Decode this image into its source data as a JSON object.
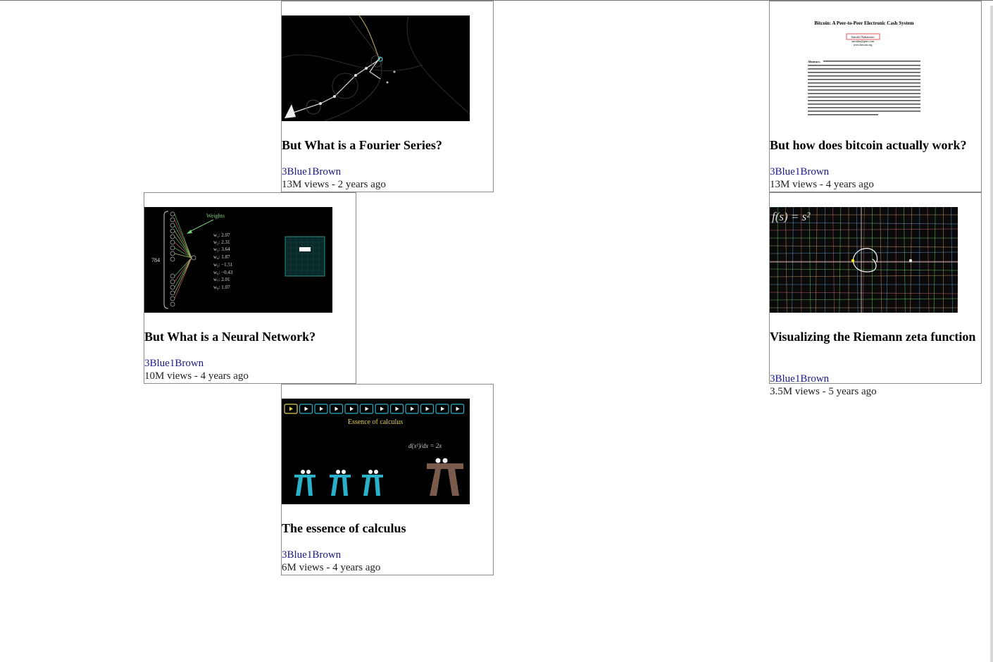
{
  "videos": [
    {
      "title": "But What is a Fourier Series?",
      "channel": "3Blue1Brown",
      "views": "13M views",
      "age": "2 years ago",
      "meta": "13M views - 2 years ago",
      "thumbnail": "fourier"
    },
    {
      "title": "But how does bitcoin actually work?",
      "channel": "3Blue1Brown",
      "views": "13M views",
      "age": "4 years ago",
      "meta": "13M views - 4 years ago",
      "thumbnail": "bitcoin-paper"
    },
    {
      "title": "But What is a Neural Network?",
      "channel": "3Blue1Brown",
      "views": "10M views",
      "age": "4 years ago",
      "meta": "10M views - 4 years ago",
      "thumbnail": "neural-network"
    },
    {
      "title": "Visualizing the Riemann zeta function",
      "channel": "3Blue1Brown",
      "views": "3.5M views",
      "age": "5 years ago",
      "meta": "3.5M views - 5 years ago",
      "thumbnail": "zeta"
    },
    {
      "title": "The essence of calculus",
      "channel": "3Blue1Brown",
      "views": "6M views",
      "age": "4 years ago",
      "meta": "6M views - 4 years ago",
      "thumbnail": "calculus"
    }
  ],
  "thumbnails": {
    "bitcoin": {
      "heading": "Bitcoin: A Peer-to-Peer Electronic Cash System",
      "author": "Satoshi Nakamoto",
      "email": "satoshin@gmx.com",
      "site": "www.bitcoin.org",
      "abstract_label": "Abstract."
    },
    "neural": {
      "weights_label": "Weights",
      "input_count": "784",
      "weights": [
        "w₁: 2.07",
        "w₂: 2.31",
        "w₃: 3.64",
        "w₄: 1.87",
        "w₅: −1.51",
        "w₆: −0.43",
        "w₇: 2.01",
        "w₈: 1.07"
      ]
    },
    "zeta": {
      "formula": "f(s) = s²"
    },
    "calculus": {
      "heading": "Essence of calculus",
      "formula": "d(x²)/dx = 2x"
    }
  },
  "colors": {
    "channel_link": "#1a1a8a",
    "card_border": "#8a8a8a"
  }
}
